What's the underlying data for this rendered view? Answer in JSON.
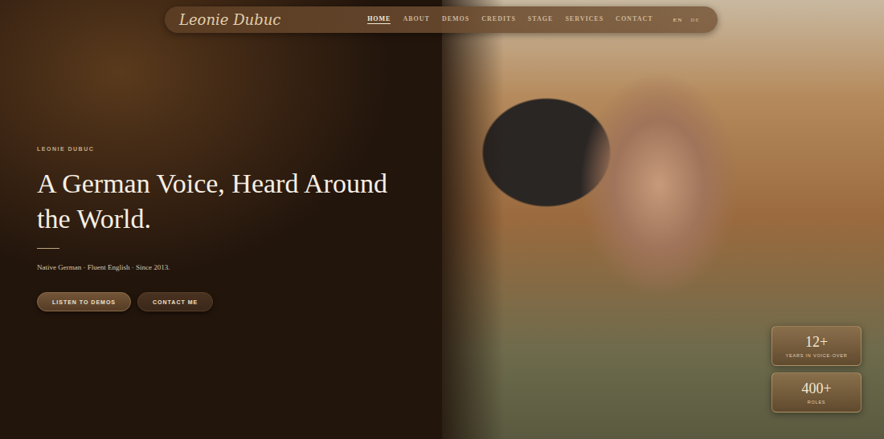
{
  "nav": {
    "logo": "Leonie Dubuc",
    "items": [
      {
        "label": "HOME",
        "selected": true
      },
      {
        "label": "ABOUT",
        "selected": false
      },
      {
        "label": "DEMOS",
        "selected": false
      },
      {
        "label": "CREDITS",
        "selected": false
      },
      {
        "label": "STAGE",
        "selected": false
      },
      {
        "label": "SERVICES",
        "selected": false
      },
      {
        "label": "CONTACT",
        "selected": false
      }
    ],
    "languages": [
      {
        "label": "EN",
        "selected": true
      },
      {
        "label": "DE",
        "selected": false
      }
    ]
  },
  "hero": {
    "eyebrow": "LEONIE DUBUC",
    "title_lines": [
      "A German Voice, Heard Around",
      "the World."
    ],
    "subtitle": "Native German · Fluent English · Since 2013.",
    "buttons": [
      {
        "label": "LISTEN TO DEMOS",
        "kind": "primary"
      },
      {
        "label": "CONTACT ME",
        "kind": "secondary"
      }
    ]
  },
  "stats": [
    {
      "value": "12+",
      "label": "YEARS IN VOICE-OVER"
    },
    {
      "value": "400+",
      "label": "ROLES"
    }
  ]
}
